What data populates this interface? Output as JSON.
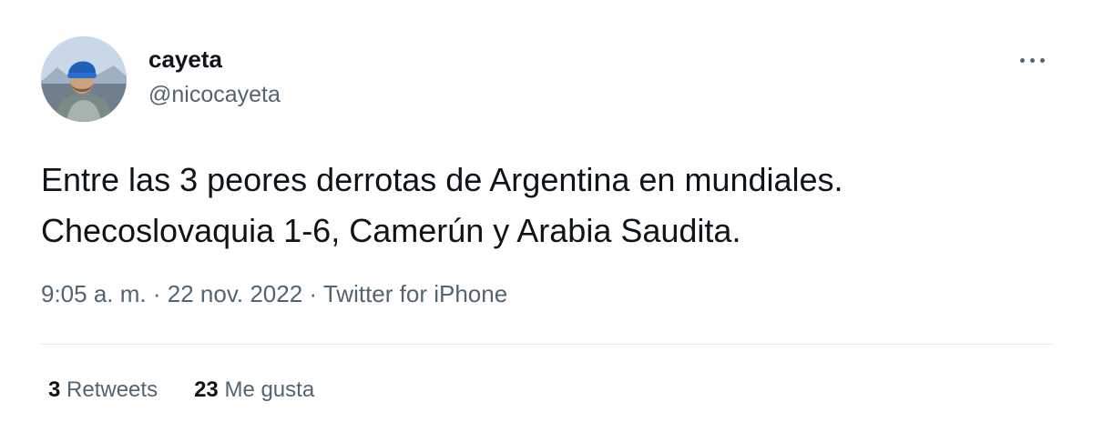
{
  "user": {
    "display_name": "cayeta",
    "handle": "@nicocayeta",
    "avatar_icon": "profile-photo"
  },
  "tweet": {
    "lines": [
      "Entre las 3 peores derrotas de Argentina en mundiales.",
      "Checoslovaquia 1-6, Camerún y Arabia Saudita."
    ]
  },
  "meta": {
    "time": "9:05 a. m.",
    "separator": "·",
    "date": "22 nov. 2022",
    "source": "Twitter for iPhone"
  },
  "stats": {
    "retweets_count": "3",
    "retweets_label": "Retweets",
    "likes_count": "23",
    "likes_label": "Me gusta"
  },
  "icons": {
    "more": "more-options-icon"
  },
  "colors": {
    "text_primary": "#0f1419",
    "text_secondary": "#536471",
    "divider": "#e3e8ec"
  }
}
